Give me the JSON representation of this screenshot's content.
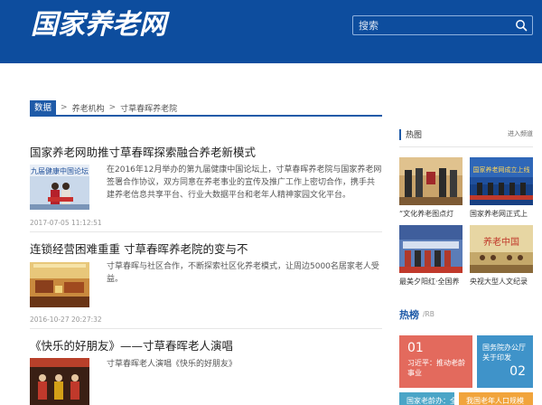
{
  "header": {
    "logo_text": "国家养老网",
    "search_placeholder": "搜索"
  },
  "breadcrumb": {
    "tag": "数据",
    "sep": ">",
    "items": [
      "养老机构",
      "寸草春晖养老院"
    ]
  },
  "articles": [
    {
      "title": "国家养老网助推寸草春晖探索融合养老新模式",
      "summary": "在2016年12月举办的第九届健康中国论坛上，寸草春晖养老院与国家养老网签署合作协议，双方同意在养老事业的宣传及推广工作上密切合作，携手共建养老信息共享平台、行业大数据平台和老年人精神家园文化平台。",
      "date": "2017-07-05 11:12:51",
      "thumb_banner": "九届健康中国论坛"
    },
    {
      "title": "连锁经营困难重重 寸草春晖养老院的变与不",
      "summary": "寸草春晖与社区合作，不断探索社区化养老模式，让周边5000名居家老人受益。",
      "date": "2016-10-27 20:27:32"
    },
    {
      "title": "《快乐的好朋友》——寸草春晖老人演唱",
      "summary": "寸草春晖老人演唱《快乐的好朋友》"
    }
  ],
  "hot": {
    "title": "热图",
    "more": "进入频道",
    "items": [
      {
        "caption": "“文化养老图点灯"
      },
      {
        "caption": "国家养老网正式上",
        "banner": "国家养老网成立上线"
      },
      {
        "caption": "最美夕阳红·全国养"
      },
      {
        "caption": "央视大型人文纪录",
        "banner": "养老中国"
      }
    ]
  },
  "ranking": {
    "title": "热榜",
    "sub": "/RB",
    "tiles": [
      {
        "num": "01",
        "text": "习近平：推动老龄事业",
        "color": "#e36a5d"
      },
      {
        "num": "02",
        "text": "国务院办公厅关于印发",
        "color": "#3f93c9"
      },
      {
        "num": "",
        "text": "国家老龄办：全",
        "color": "#4aa5c7"
      },
      {
        "num": "",
        "text": "我国老年人口规模",
        "color": "#f1a43c"
      }
    ]
  },
  "colors": {
    "header_bg": "#0d4d9e",
    "accent": "#1e5aa8"
  }
}
